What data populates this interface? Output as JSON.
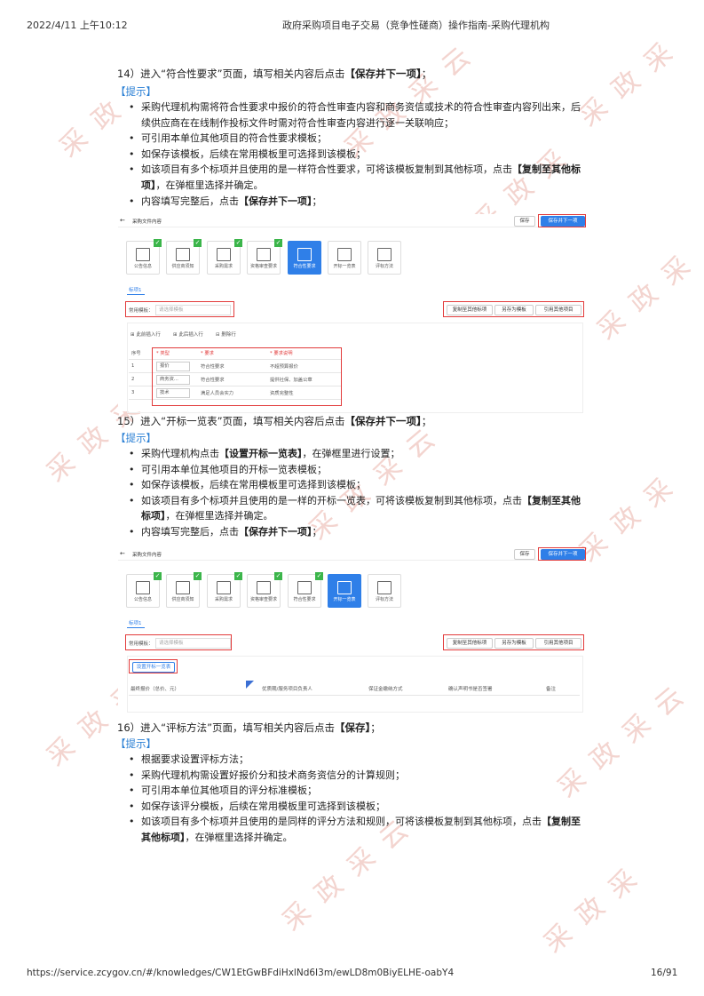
{
  "header": {
    "datetime": "2022/4/11 上午10:12",
    "title": "政府采购项目电子交易（竞争性磋商）操作指南-采购代理机构"
  },
  "footer": {
    "url": "https://service.zcygov.cn/#/knowledges/CW1EtGwBFdiHxlNd6I3m/ewLD8m0BiyELHE-oabY4",
    "page": "16/91"
  },
  "watermark": "采 政 采 云",
  "sections": [
    {
      "step": "14）进入“符合性要求”页面，填写相关内容后点击【保存并下一项】；",
      "tip": "【提示】",
      "bullets": [
        "采购代理机构需将符合性要求中报价的符合性审查内容和商务资信或技术的符合性审查内容列出来，后续供应商在在线制作投标文件时需对符合性审查内容进行逐一关联响应；",
        "可引用本单位其他项目的符合性要求模板；",
        "如保存该模板，后续在常用模板里可选择到该模板；",
        "如该项目有多个标项并且使用的是一样符合性要求，可将该模板复制到其他标项，点击【复制至其他标项】，在弹框里选择并确定。",
        "内容填写完整后，点击【保存并下一项】；"
      ]
    },
    {
      "step": "15）进入“开标一览表”页面，填写相关内容后点击【保存并下一项】；",
      "tip": "【提示】",
      "bullets": [
        "采购代理机构点击【设置开标一览表】，在弹框里进行设置；",
        "可引用本单位其他项目的开标一览表模板；",
        "如保存该模板，后续在常用模板里可选择到该模板；",
        "如该项目有多个标项并且使用的是一样的开标一览表，可将该模板复制到其他标项，点击【复制至其他标项】，在弹框里选择并确定。",
        "内容填写完整后，点击【保存并下一项】；"
      ]
    },
    {
      "step": "16）进入“评标方法”页面，填写相关内容后点击【保存】；",
      "tip": "【提示】",
      "bullets": [
        "根据要求设置评标方法；",
        "采购代理机构需设置好报价分和技术商务资信分的计算规则；",
        "可引用本单位其他项目的评分标准模板；",
        "如保存该评分模板，后续在常用模板里可选择到该模板；",
        "如该项目有多个标项并且使用的是同样的评分方法和规则，可将该模板复制到其他标项，点击【复制至其他标项】，在弹框里选择并确定。"
      ]
    }
  ],
  "shot1": {
    "page_title": "采购文件内容",
    "save": "保存",
    "save_next": "保存并下一项",
    "cards": [
      "公告信息",
      "供应商须知",
      "采购需求",
      "资格审查要求",
      "符合性要求",
      "开标一览表",
      "评标方法"
    ],
    "tab": "标项1",
    "template_label": "常用模板：",
    "template_placeholder": "请选择模板",
    "copy_btn": "复制至其他标项",
    "saveas_btn": "另存为模板",
    "cite_btn": "引用其他项目",
    "toolbar": [
      "此前插入行",
      "此后插入行",
      "删除行"
    ],
    "columns": [
      "序号",
      "* 类型",
      "* 要求",
      "* 要求说明"
    ],
    "rows": [
      [
        "1",
        "报价",
        "符合性要求",
        "不超预算报价"
      ],
      [
        "2",
        "商务资...",
        "符合性要求",
        "提供社保、加盖公章"
      ],
      [
        "3",
        "技术",
        "满足人员会实力",
        "资质完整性"
      ]
    ]
  },
  "shot2": {
    "page_title": "采购文件内容",
    "save": "保存",
    "save_next": "保存并下一项",
    "cards": [
      "公告信息",
      "供应商须知",
      "采购需求",
      "资格审查要求",
      "符合性要求",
      "开标一览表",
      "评标方法"
    ],
    "tab": "标项1",
    "template_label": "常用模板：",
    "template_placeholder": "请选择模板",
    "copy_btn": "复制至其他标项",
    "saveas_btn": "另存为模板",
    "cite_btn": "引用其他项目",
    "setup_btn": "设置开标一览表",
    "columns": [
      "最终报价（总价、元）",
      "优质期/服务项目负责人",
      "保证金缴纳方式",
      "确认声明书是否签署",
      "备注"
    ]
  }
}
